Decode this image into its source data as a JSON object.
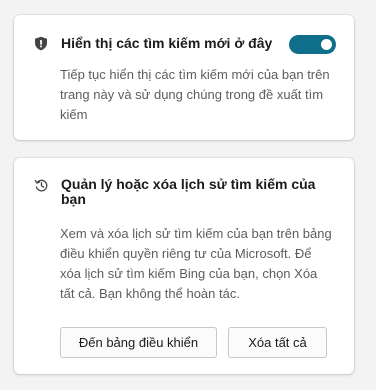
{
  "show_searches": {
    "title": "Hiển thị các tìm kiếm mới ở đây",
    "description": "Tiếp tục hiển thị các tìm kiếm mới của bạn trên trang này và sử dụng chúng trong đề xuất tìm kiếm",
    "toggle_on": true,
    "icon": "shield-icon",
    "accent_color": "#0f6f8a"
  },
  "manage_history": {
    "title": "Quản lý hoặc xóa lịch sử tìm kiếm của bạn",
    "description": "Xem và xóa lịch sử tìm kiếm của bạn trên bảng điều khiển quyền riêng tư của Microsoft. Để xóa lịch sử tìm kiếm Bing của bạn, chọn Xóa tất cả. Bạn không thể hoàn tác.",
    "icon": "history-icon",
    "dashboard_button": "Đến bảng điều khiển",
    "clear_all_button": "Xóa tất cả"
  }
}
